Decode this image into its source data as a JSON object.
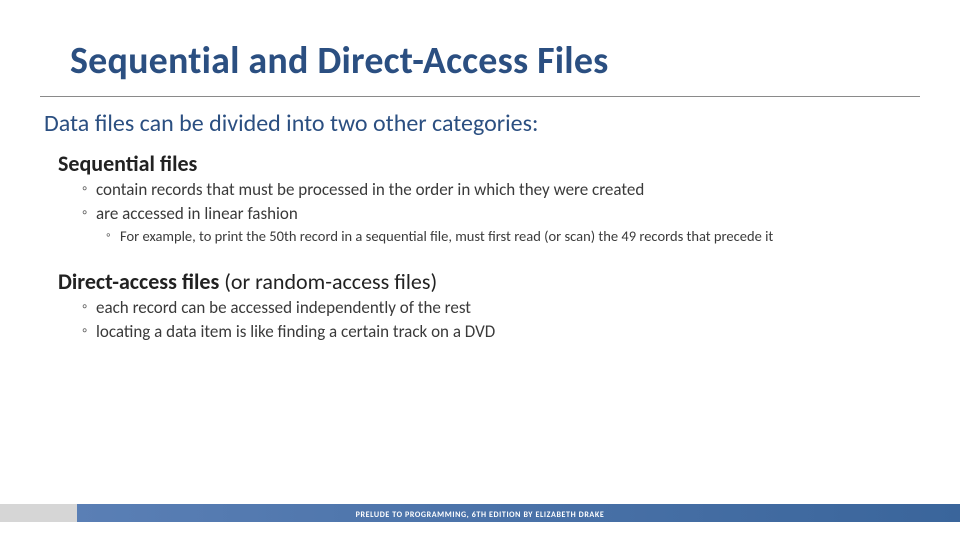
{
  "title": "Sequential and Direct-Access Files",
  "intro": "Data files can be divided into two other categories:",
  "sections": [
    {
      "heading": "Sequential files",
      "heading_paren": "",
      "bullets": [
        "contain records that must be processed in the order in which they were created",
        "are accessed in linear fashion"
      ],
      "subbullets": [
        "For example, to print the 50th record in a sequential file, must first read (or scan) the 49 records that precede it"
      ]
    },
    {
      "heading": "Direct-access files",
      "heading_paren": " (or random-access files)",
      "bullets": [
        "each record can be accessed independently of the rest",
        "locating a data item is like finding a certain track on a DVD"
      ],
      "subbullets": []
    }
  ],
  "footer": "PRELUDE TO PROGRAMMING, 6TH EDITION BY ELIZABETH DRAKE"
}
